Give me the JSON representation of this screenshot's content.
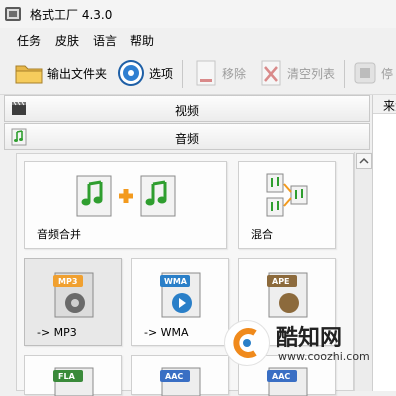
{
  "window": {
    "title": "格式工厂 4.3.0"
  },
  "menu": [
    "任务",
    "皮肤",
    "语言",
    "帮助"
  ],
  "toolbar": {
    "output_folder": "输出文件夹",
    "options": "选项",
    "remove": "移除",
    "clear_list": "清空列表",
    "stop": "停"
  },
  "categories": {
    "video": "视频",
    "audio": "音频"
  },
  "right_panel": {
    "header": "来源"
  },
  "tiles": {
    "audio_join": "音频合并",
    "mix": "混合",
    "to_mp3": "-> MP3",
    "to_wma": "-> WMA",
    "badges": {
      "mp3": "MP3",
      "wma": "WMA",
      "ape": "APE",
      "fla": "FLA",
      "aac1": "AAC",
      "aac2": "AAC"
    }
  },
  "watermark": {
    "name": "酷知网",
    "url": "www.coozhi.com"
  },
  "colors": {
    "note_green": "#2f9e2f",
    "plus_orange": "#f39a1e",
    "mp3_orange": "#f0a030",
    "wma_blue": "#2a7fc8",
    "ape_brown": "#8c6a3c",
    "fla_green": "#3a8a3a",
    "aac_blue": "#3a6fc4",
    "watermark_orange": "#f08a1c"
  },
  "icons": [
    "app-icon",
    "folder-icon",
    "options-gear-icon",
    "remove-icon",
    "clear-list-icon",
    "stop-icon",
    "video-clapper-icon",
    "audio-note-icon",
    "scroll-up-arrow-icon",
    "watermark-logo-icon"
  ]
}
